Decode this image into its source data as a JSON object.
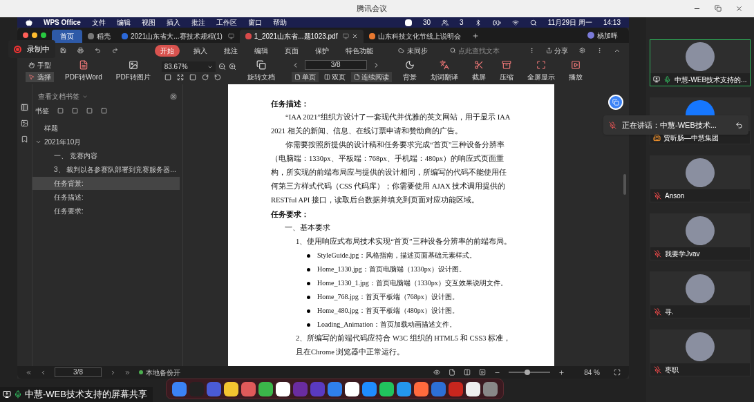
{
  "meeting": {
    "title": "腾讯会议"
  },
  "recording": {
    "label": "录制中"
  },
  "share_label": "中慧-WEB技术支持的屏幕共享",
  "menubar": {
    "app": "WPS Office",
    "items": [
      "文件",
      "编辑",
      "视图",
      "插入",
      "批注",
      "工作区",
      "窗口",
      "帮助"
    ],
    "counter_a": "30",
    "counter_b": "3",
    "date": "11月29日 周一",
    "time": "14:13"
  },
  "wps": {
    "tabs": [
      {
        "label": "首页",
        "selected": false,
        "kind": "home"
      },
      {
        "label": "稻壳",
        "selected": false,
        "kind": "app"
      },
      {
        "label": "2021山东省大...赛技术规程(1)",
        "selected": false,
        "kind": "word"
      },
      {
        "label": "1_2021山东省...题1023.pdf",
        "selected": true,
        "kind": "pdf"
      },
      {
        "label": "山东科技文化节线上说明会",
        "selected": false,
        "kind": "ppt"
      }
    ],
    "user": "杨加晖",
    "ribbon": [
      {
        "label": "开始",
        "selected": true
      },
      {
        "label": "插入",
        "selected": false
      },
      {
        "label": "批注",
        "selected": false
      },
      {
        "label": "编辑",
        "selected": false
      },
      {
        "label": "页面",
        "selected": false
      },
      {
        "label": "保护",
        "selected": false
      },
      {
        "label": "特色功能",
        "selected": false
      }
    ],
    "sync": "未同步",
    "search": {
      "placeholder": "点此查找文本"
    },
    "share": "分享",
    "tools": {
      "hand": {
        "label": "手型",
        "selected": false
      },
      "select": {
        "label": "选择",
        "selected": true
      },
      "convert": [
        "PDF转Word",
        "PDF转图片"
      ],
      "zoom": "83.67%",
      "rotate": "旋转文档",
      "page": "3/8",
      "view_modes": [
        {
          "label": "单页",
          "selected": true
        },
        {
          "label": "双页",
          "selected": false
        },
        {
          "label": "连续阅读",
          "selected": true
        }
      ],
      "right": [
        "背景",
        "划词翻译",
        "截屏",
        "压缩",
        "全屏显示",
        "播放"
      ]
    },
    "sidebar": {
      "title": "查看文档书签",
      "label": "书签",
      "tree": [
        {
          "label": "样题",
          "selected": false
        },
        {
          "label": "2021年10月",
          "selected": false,
          "expanded": true,
          "children": [
            {
              "label": "一、 竞赛内容",
              "selected": false
            },
            {
              "label": "3、 裁判以各参赛队部署到竞赛服务器...",
              "selected": false
            },
            {
              "label": "任务背景:",
              "selected": true
            },
            {
              "label": "任务描述:",
              "selected": false
            },
            {
              "label": "任务要求:",
              "selected": false
            }
          ]
        }
      ]
    },
    "document": [
      {
        "kind": "heading",
        "text": "任务描述："
      },
      {
        "kind": "para",
        "text": "“IAA 2021”组织方设计了一套现代并优雅的英文网站，用于显示 IAA 2021 相关的新闻、信息、在线订票申请和赞助商的广告。"
      },
      {
        "kind": "para",
        "text": "你需要按照所提供的设计稿和任务要求完成“首页”三种设备分辨率（电脑端：1330px、平板端：768px、手机端：480px）的响应式页面重构，所实现的前端布局应与提供的设计相同，所编写的代码不能使用任何第三方样式代码（CSS 代码库）；你需要使用 AJAX 技术调用提供的 RESTful API 接口，读取后台数据并填充到页面对应功能区域。"
      },
      {
        "kind": "heading",
        "text": "任务要求："
      },
      {
        "kind": "section",
        "text": "一、基本要求"
      },
      {
        "kind": "item",
        "text": "1、使用响应式布局技术实现“首页”三种设备分辨率的前端布局。"
      },
      {
        "kind": "bullet",
        "text": "StyleGuide.jpg：风格指南，描述页面基础元素样式。"
      },
      {
        "kind": "bullet",
        "text": "Home_1330.jpg：首页电脑端（1330px）设计图。"
      },
      {
        "kind": "bullet",
        "text": "Home_1330_1.jpg：首页电脑端（1330px）交互效果说明文件。"
      },
      {
        "kind": "bullet",
        "text": "Home_768.jpg：首页平板端（768px）设计图。"
      },
      {
        "kind": "bullet",
        "text": "Home_480.jpg：首页平板端（480px）设计图。"
      },
      {
        "kind": "bullet",
        "text": "Loading_Animation：首页加载动画描述文件。"
      },
      {
        "kind": "item",
        "text": "2、所编写的前端代码应符合 W3C 组织的 HTML5 和 CSS3 标准，且在Chrome 浏览器中正常运行。"
      }
    ],
    "status": {
      "page": "3/8",
      "backup": "本地备份开",
      "zoom": "84 %",
      "zoom_slider": {
        "level": 0.45
      }
    }
  },
  "speaking": "正在讲话：中慧-WEB技术...",
  "participants": [
    {
      "name": "中慧-WEB技术支持的...",
      "kind": "presenter",
      "muted": false,
      "selected": true
    },
    {
      "name": "贾昕肠—中慧集团",
      "kind": "org",
      "selected": false
    },
    {
      "name": "Anson",
      "kind": "member",
      "muted": true,
      "selected": false
    },
    {
      "name": "我要学Jvav",
      "kind": "member",
      "muted": true,
      "selected": false
    },
    {
      "name": "寻.",
      "kind": "member",
      "muted": true,
      "selected": false
    },
    {
      "name": "枣职",
      "kind": "member",
      "muted": true,
      "selected": false
    }
  ]
}
